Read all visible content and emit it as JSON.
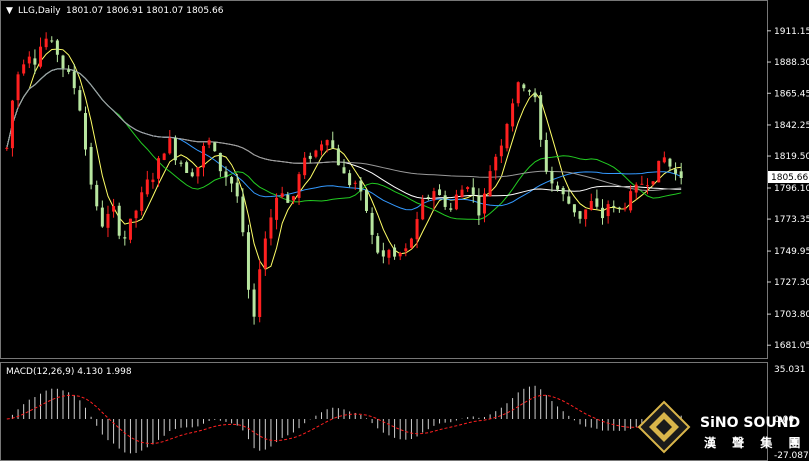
{
  "chart_data": [
    {
      "type": "candlestick",
      "title": "LLG,Daily",
      "ohlc_label": "1801.07 1806.91 1801.07 1805.66",
      "current_price": 1805.66,
      "ylim": [
        1679,
        1922
      ],
      "yticks": [
        "1911.15",
        "1888.30",
        "1865.45",
        "1842.25",
        "1819.50",
        "1796.10",
        "1773.35",
        "1749.95",
        "1727.30",
        "1703.80",
        "1681.05"
      ],
      "price_path": [
        1825,
        1860,
        1880,
        1890,
        1895,
        1890,
        1900,
        1905,
        1900,
        1895,
        1885,
        1878,
        1870,
        1855,
        1825,
        1800,
        1780,
        1770,
        1775,
        1780,
        1765,
        1760,
        1770,
        1780,
        1790,
        1800,
        1805,
        1815,
        1825,
        1830,
        1820,
        1815,
        1810,
        1808,
        1812,
        1825,
        1830,
        1820,
        1810,
        1805,
        1800,
        1790,
        1760,
        1720,
        1698,
        1740,
        1760,
        1775,
        1790,
        1795,
        1785,
        1790,
        1805,
        1815,
        1820,
        1823,
        1830,
        1835,
        1825,
        1815,
        1805,
        1800,
        1800,
        1790,
        1780,
        1760,
        1750,
        1745,
        1750,
        1745,
        1748,
        1750,
        1760,
        1770,
        1785,
        1790,
        1795,
        1790,
        1785,
        1780,
        1790,
        1795,
        1800,
        1790,
        1780,
        1790,
        1810,
        1820,
        1830,
        1845,
        1860,
        1870,
        1872,
        1868,
        1860,
        1830,
        1810,
        1800,
        1795,
        1790,
        1785,
        1780,
        1775,
        1780,
        1785,
        1780,
        1775,
        1785,
        1780,
        1780,
        1785,
        1790,
        1795,
        1800,
        1802,
        1805,
        1812,
        1818,
        1812,
        1806,
        1805
      ]
    },
    {
      "type": "macd",
      "title": "MACD(12,26,9) 4.130 1.998",
      "ylim": [
        -27.087,
        35.031
      ],
      "yticks": [
        "35.031",
        "0.00",
        "-27.087"
      ]
    }
  ],
  "colors": {
    "background": "#000000",
    "up": "#ff2020",
    "down": "#b8e6a0",
    "ma_fast": "#ffff66",
    "ma_slow": "#22cc22",
    "ma_blue": "#3399ff",
    "ma_white": "#ffffff",
    "ma_gray": "#999999",
    "macd_bar": "#d0d0d0",
    "signal": "#ff2020"
  },
  "logo": {
    "name": "SiNO SOUND",
    "chinese": "漢 聲 集 團"
  }
}
